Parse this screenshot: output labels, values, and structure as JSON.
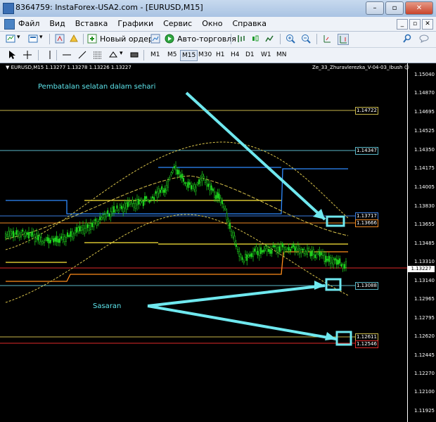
{
  "window": {
    "title": "8364759: InstaForex-USA2.com - [EURUSD,M15]",
    "buttons": [
      "–",
      "▫",
      "✕"
    ]
  },
  "menu": {
    "items": [
      "Файл",
      "Вид",
      "Вставка",
      "Графики",
      "Сервис",
      "Окно",
      "Справка"
    ],
    "mdi_buttons": [
      "_",
      "▫",
      "✕"
    ]
  },
  "toolbar": {
    "new_order": "Новый ордер",
    "auto_trading": "Авто-торговля"
  },
  "timeframes": [
    "M1",
    "M5",
    "M15",
    "M30",
    "H1",
    "H4",
    "D1",
    "W1",
    "MN"
  ],
  "active_timeframe": "M15",
  "chart": {
    "header_left": "▼ EURUSD,M15  1.13277 1.13278 1.13226 1.13227",
    "header_right": "Ze_33_Zhuravlerezka_V-04-03_Ibush ☺",
    "annotation_top": "Pembatalan selatan dalam sehari",
    "annotation_target": "Sasaran",
    "current_price": "1.13227",
    "axis_labels": [
      "1.15040",
      "1.14870",
      "1.14695",
      "1.14525",
      "1.14350",
      "1.14175",
      "1.14005",
      "1.13830",
      "1.13655",
      "1.13485",
      "1.13310",
      "1.13140",
      "1.12965",
      "1.12795",
      "1.12620",
      "1.12445",
      "1.12270",
      "1.12100",
      "1.11925"
    ],
    "levels": [
      {
        "price": "1.14722",
        "color": "#c7b64a"
      },
      {
        "price": "1.14347",
        "color": "#5ab7c7"
      },
      {
        "price": "1.13717",
        "color": "#3a7de0"
      },
      {
        "price": "1.13666",
        "color": "#f08a24"
      },
      {
        "price": "1.13088",
        "color": "#5ab7c7"
      },
      {
        "price": "1.12611",
        "color": "#c7b64a"
      },
      {
        "price": "1.12546",
        "color": "#e02a2a"
      }
    ],
    "colors": {
      "candle": "#1fd61f",
      "arrow": "#6fe8ef",
      "yellow": "#ffea3a",
      "orange": "#ff8c1a",
      "blue": "#2f8bff",
      "red": "#ff2a2a",
      "dashed": "#d8c24a"
    }
  }
}
